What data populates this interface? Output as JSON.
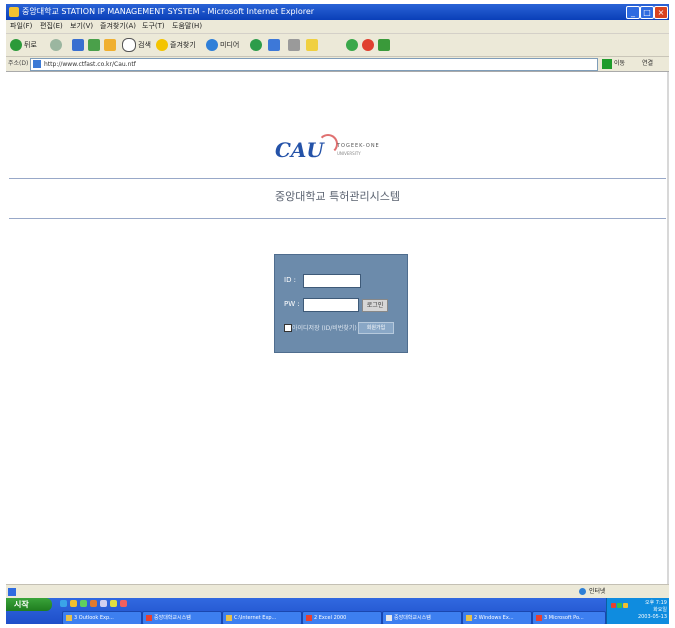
{
  "window": {
    "title": "중앙대학교 STATION IP MANAGEMENT SYSTEM - Microsoft Internet Explorer",
    "minimize": "_",
    "maximize": "□",
    "close": "×"
  },
  "menu": [
    "파일(F)",
    "편집(E)",
    "보기(V)",
    "즐겨찾기(A)",
    "도구(T)",
    "도움말(H)"
  ],
  "toolbar": {
    "back": "뒤로",
    "search": "검색",
    "favorites": "즐겨찾기",
    "media": "미디어"
  },
  "address": {
    "label": "주소(D)",
    "url": "http://www.ctfast.co.kr/Cau.ntf",
    "go_label": "이동",
    "links_label": "연결"
  },
  "logo": {
    "wordmark": "CAU",
    "tagline": "TOGEEK-ONE",
    "tagline2": "UNIVERSITY"
  },
  "page": {
    "title": "중앙대학교 특허관리시스템"
  },
  "login": {
    "id_label": "ID :",
    "pw_label": "PW :",
    "id_value": "",
    "pw_value": "",
    "login_button": "로그인",
    "remember_label": "아이디저장 (ID/비번찾기)",
    "find_button": "회원가입"
  },
  "status": {
    "zone": "인터넷"
  },
  "taskbar": {
    "start": "시작",
    "tasks": [
      "3 Outlook Exp...",
      "중앙대학교시스템",
      "C:\\Internet Exp...",
      "2 Excel 2000",
      "중앙대학교시스템",
      "2 Windows Ex...",
      "3 Microsoft Po..."
    ],
    "clock_time": "오후 7:19",
    "clock_day": "화요일",
    "clock_date": "2003-05-13"
  },
  "colors": {
    "titlebar": "#0a3fb8",
    "panel": "#6c8bab",
    "divider": "#98a8c8"
  }
}
